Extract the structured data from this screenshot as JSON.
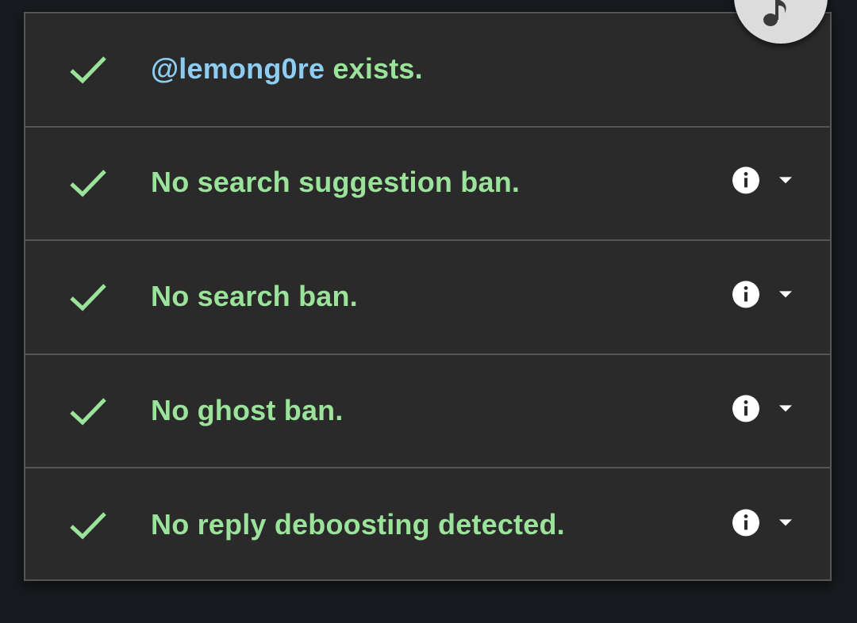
{
  "colors": {
    "background": "#171a1e",
    "panel": "#2a2a2a",
    "border": "#555555",
    "success_text": "#9be39b",
    "handle_text": "#8ecdf2",
    "icon_white": "#ffffff",
    "fab": "#dcdcdc"
  },
  "results": {
    "exists": {
      "handle": "@lemong0re",
      "text": " exists."
    },
    "rows": [
      {
        "text": "No search suggestion ban.",
        "icon": "check-icon"
      },
      {
        "text": "No search ban.",
        "icon": "check-icon"
      },
      {
        "text": "No ghost ban.",
        "icon": "check-icon"
      },
      {
        "text": "No reply deboosting detected.",
        "icon": "check-icon"
      }
    ]
  },
  "fab": {
    "icon": "music-note-icon"
  }
}
